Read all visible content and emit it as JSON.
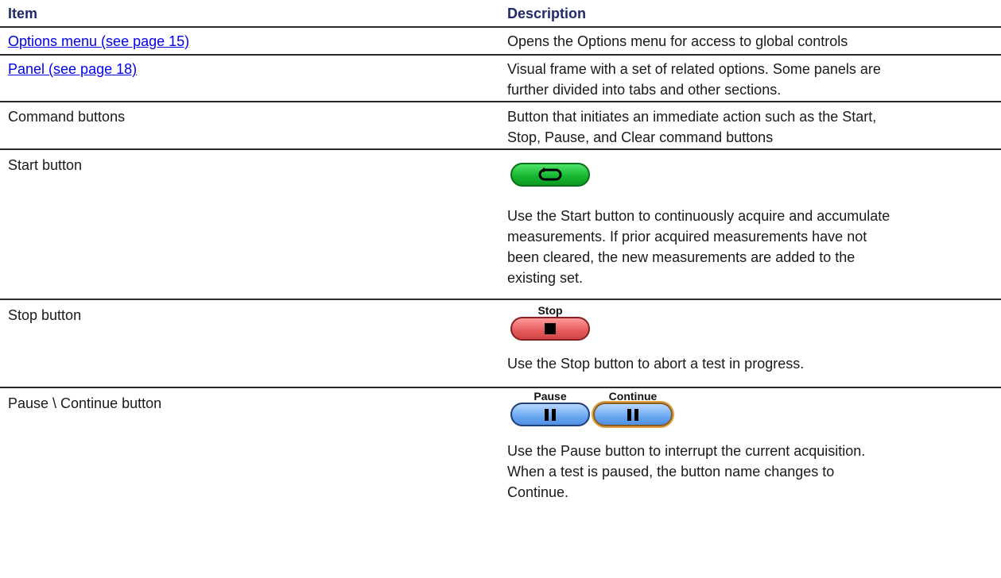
{
  "header": {
    "item": "Item",
    "description": "Description"
  },
  "rows": [
    {
      "item": "Options menu (see page 15)",
      "description": "Opens the Options menu for access to global controls"
    },
    {
      "item": "Panel (see page 18)",
      "description_line1": "Visual frame with a set of related options. Some panels are",
      "description_line2": "further divided into tabs and other sections."
    },
    {
      "item": "Command buttons",
      "description_line1": "Button that initiates an immediate action such as the Start,",
      "description_line2": "Stop, Pause, and Clear command buttons"
    },
    {
      "item": "Start button",
      "button_icon": "refresh-loop-icon",
      "description_lines": [
        "Use the Start button to continuously acquire and accumulate",
        "measurements. If prior acquired measurements have not",
        "been cleared, the new measurements are added to the",
        "existing set."
      ]
    },
    {
      "item": "Stop button",
      "button_caption": "Stop",
      "button_icon": "stop-square-icon",
      "description": "Use the Stop button to abort a test in progress."
    },
    {
      "item": "Pause \\ Continue button",
      "pause_caption": "Pause",
      "continue_caption": "Continue",
      "button_icon": "pause-bars-icon",
      "description_lines": [
        "Use the Pause button to interrupt the current acquisition.",
        "When a test is paused, the button name changes to",
        "Continue."
      ]
    }
  ],
  "colors": {
    "header_text": "#1e2a6b",
    "link": "#0000ee",
    "start_green": "#14b52e",
    "stop_red": "#e65a5a",
    "pause_blue": "#6aa8f2"
  }
}
